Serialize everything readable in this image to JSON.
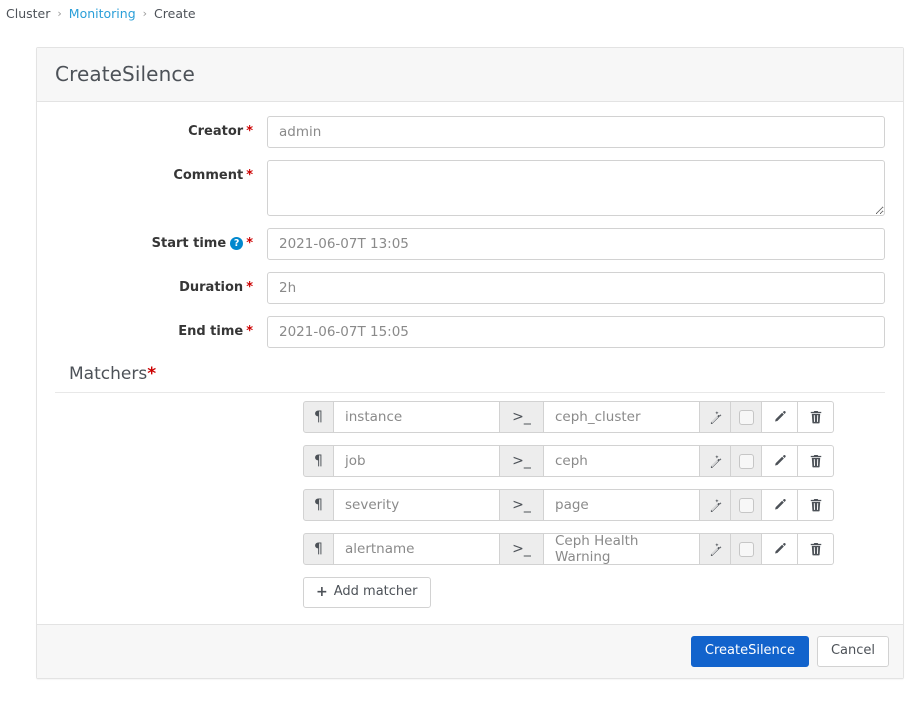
{
  "breadcrumb": {
    "separator": "›",
    "items": [
      {
        "label": "Cluster",
        "link": false
      },
      {
        "label": "Monitoring",
        "link": true
      },
      {
        "label": "Create",
        "link": false
      }
    ]
  },
  "card": {
    "title": "CreateSilence"
  },
  "form": {
    "creator": {
      "label": "Creator",
      "required_mark": "*",
      "value": "admin"
    },
    "comment": {
      "label": "Comment",
      "required_mark": "*",
      "value": ""
    },
    "start_time": {
      "label": "Start time",
      "help_glyph": "?",
      "required_mark": "*",
      "value": "2021-06-07T 13:05"
    },
    "duration": {
      "label": "Duration",
      "required_mark": "*",
      "value": "2h"
    },
    "end_time": {
      "label": "End time",
      "required_mark": "*",
      "value": "2021-06-07T 15:05"
    }
  },
  "matchers": {
    "heading": "Matchers",
    "required_mark": "*",
    "name_addon_glyph": "¶",
    "value_addon_glyph": ">_",
    "rows": [
      {
        "name": "instance",
        "value": "ceph_cluster"
      },
      {
        "name": "job",
        "value": "ceph"
      },
      {
        "name": "severity",
        "value": "page"
      },
      {
        "name": "alertname",
        "value": "Ceph Health Warning"
      }
    ],
    "add_button": {
      "plus": "+",
      "label": "Add matcher"
    }
  },
  "footer": {
    "submit_label": "CreateSilence",
    "cancel_label": "Cancel"
  },
  "colors": {
    "primary": "#1263cc",
    "link": "#2b9fd8",
    "required": "#cc0000",
    "help": "#0088ce",
    "panel_bg": "#f7f7f7",
    "border": "#e3e3e3"
  }
}
